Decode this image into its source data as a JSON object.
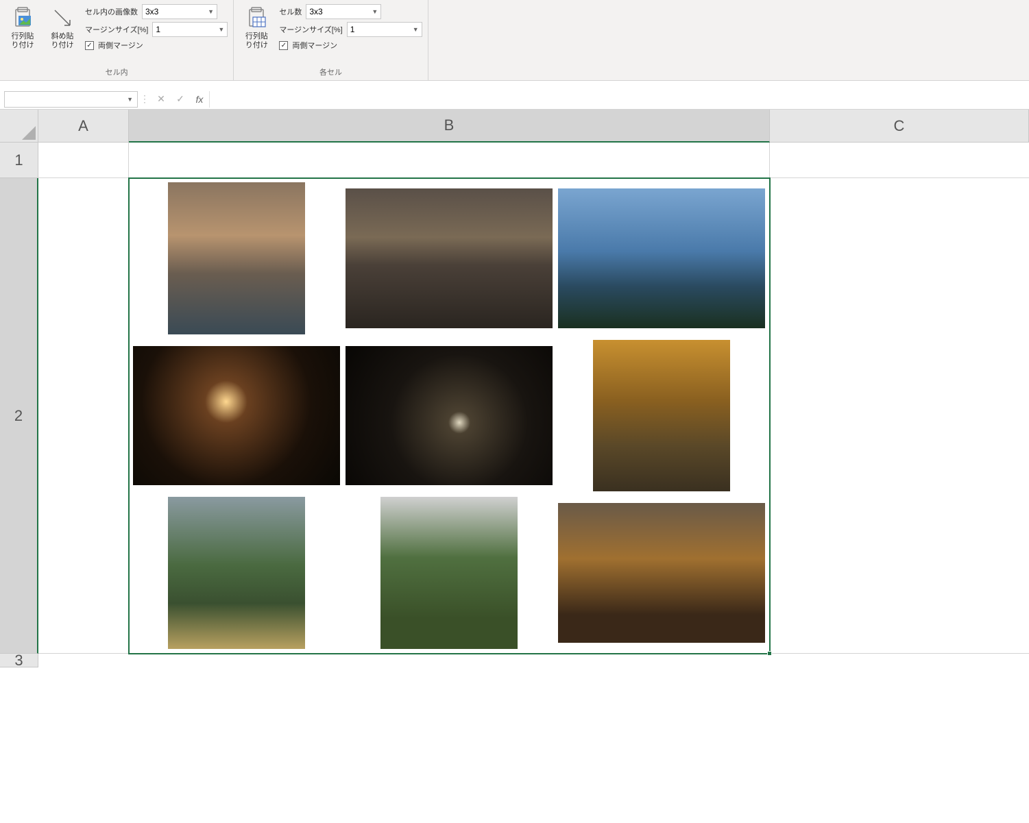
{
  "ribbon": {
    "group1": {
      "btn1": "行列貼\nり付け",
      "btn2": "斜め貼\nり付け",
      "label1": "セル内の画像数",
      "combo1": "3x3",
      "label2": "マージンサイズ[%]",
      "combo2": "1",
      "chk1": "両側マージン",
      "group_label": "セル内"
    },
    "group2": {
      "btn1": "行列貼\nり付け",
      "label1": "セル数",
      "combo1": "3x3",
      "label2": "マージンサイズ[%]",
      "combo2": "1",
      "chk1": "両側マージン",
      "group_label": "各セル"
    }
  },
  "formula_bar": {
    "name_box": "",
    "cancel": "✕",
    "enter": "✓",
    "fx": "fx",
    "value": ""
  },
  "columns": [
    "A",
    "B",
    "C"
  ],
  "rows": [
    "1",
    "2",
    "3"
  ],
  "selected_cell": "B2",
  "images": {
    "grid_layout": "3x3",
    "count": 9
  }
}
